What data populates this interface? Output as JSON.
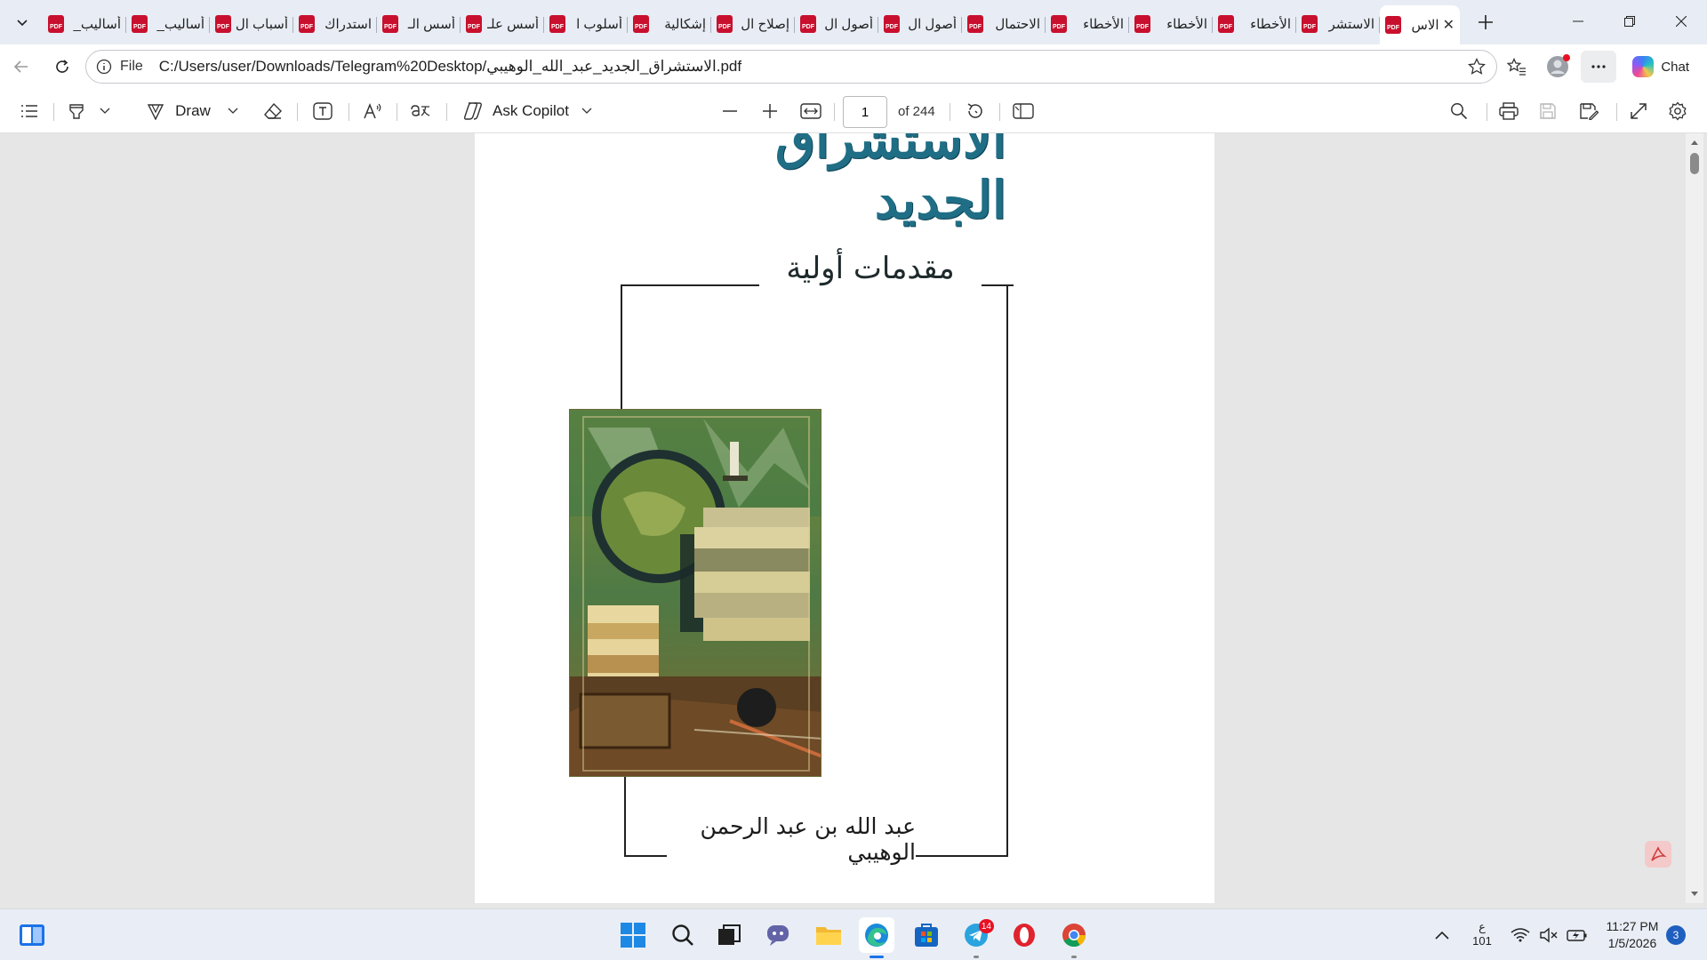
{
  "browser": {
    "tabs": [
      {
        "title": "أساليب_"
      },
      {
        "title": "أساليب_"
      },
      {
        "title": "أسباب ال"
      },
      {
        "title": "استدراك"
      },
      {
        "title": "أسس الـ"
      },
      {
        "title": "أسس علـ"
      },
      {
        "title": "أسلوب ا"
      },
      {
        "title": "إشكالية"
      },
      {
        "title": "إصلاح ال"
      },
      {
        "title": "أصول ال"
      },
      {
        "title": "أصول ال"
      },
      {
        "title": "الاحتمال"
      },
      {
        "title": "الأخطاء"
      },
      {
        "title": "الأخطاء"
      },
      {
        "title": "الأخطاء"
      },
      {
        "title": "الاستشر"
      },
      {
        "title": "الاس",
        "active": true
      }
    ],
    "address": {
      "scheme_label": "File",
      "url": "C:/Users/user/Downloads/Telegram%20Desktop/الاستشراق_الجديد_عبد_الله_الوهيبي.pdf"
    },
    "chat_label": "Chat"
  },
  "pdf_toolbar": {
    "draw_label": "Draw",
    "copilot_label": "Ask Copilot",
    "page_current": "1",
    "page_total_label": "of 244"
  },
  "document": {
    "title": "الاستشراق الجديد",
    "subtitle": "مقدمات أولية",
    "author": "عبد الله بن عبد الرحمن الوهيبي"
  },
  "taskbar": {
    "telegram_badge": "14",
    "lang_top": "ع",
    "lang_bottom": "101",
    "time": "11:27 PM",
    "date": "1/5/2026",
    "notifications": "3"
  }
}
